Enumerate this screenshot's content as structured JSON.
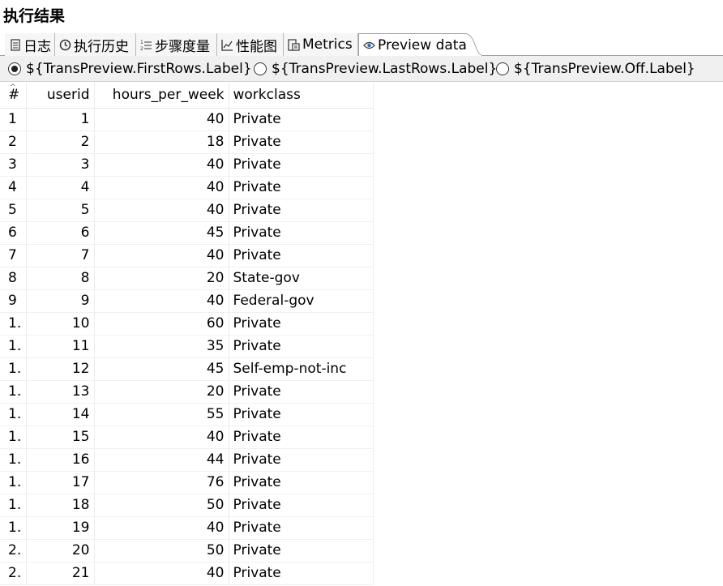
{
  "panel": {
    "title": "执行结果"
  },
  "tabs": [
    {
      "label": "日志",
      "icon": "log-icon"
    },
    {
      "label": "执行历史",
      "icon": "history-icon"
    },
    {
      "label": "步骤度量",
      "icon": "step-metrics-icon"
    },
    {
      "label": "性能图",
      "icon": "performance-chart-icon"
    },
    {
      "label": "Metrics",
      "icon": "metrics-icon"
    },
    {
      "label": "Preview data",
      "icon": "eye-icon",
      "active": true
    }
  ],
  "preview_options": {
    "first_rows": "${TransPreview.FirstRows.Label}",
    "last_rows": "${TransPreview.LastRows.Label}",
    "off": "${TransPreview.Off.Label}",
    "selected": "first_rows"
  },
  "table": {
    "columns": [
      "#",
      "userid",
      "hours_per_week",
      "workclass"
    ],
    "rows": [
      [
        "1",
        "1",
        "40",
        "Private"
      ],
      [
        "2",
        "2",
        "18",
        "Private"
      ],
      [
        "3",
        "3",
        "40",
        "Private"
      ],
      [
        "4",
        "4",
        "40",
        "Private"
      ],
      [
        "5",
        "5",
        "40",
        "Private"
      ],
      [
        "6",
        "6",
        "45",
        "Private"
      ],
      [
        "7",
        "7",
        "40",
        "Private"
      ],
      [
        "8",
        "8",
        "20",
        "State-gov"
      ],
      [
        "9",
        "9",
        "40",
        "Federal-gov"
      ],
      [
        "1.",
        "10",
        "60",
        "Private"
      ],
      [
        "1.",
        "11",
        "35",
        "Private"
      ],
      [
        "1.",
        "12",
        "45",
        "Self-emp-not-inc"
      ],
      [
        "1.",
        "13",
        "20",
        "Private"
      ],
      [
        "1.",
        "14",
        "55",
        "Private"
      ],
      [
        "1.",
        "15",
        "40",
        "Private"
      ],
      [
        "1.",
        "16",
        "44",
        "Private"
      ],
      [
        "1.",
        "17",
        "76",
        "Private"
      ],
      [
        "1.",
        "18",
        "50",
        "Private"
      ],
      [
        "1.",
        "19",
        "40",
        "Private"
      ],
      [
        "2.",
        "20",
        "50",
        "Private"
      ],
      [
        "2.",
        "21",
        "40",
        "Private"
      ]
    ]
  }
}
